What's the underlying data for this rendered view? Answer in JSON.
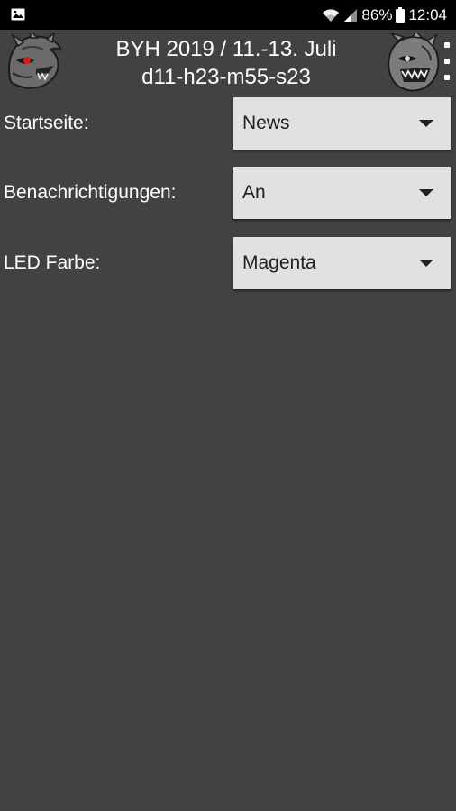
{
  "status_bar": {
    "battery_percent": "86%",
    "time": "12:04",
    "left_icon": "image-icon",
    "icons": [
      "wifi-icon",
      "signal-icon",
      "battery-icon"
    ]
  },
  "app_bar": {
    "title_line1": "BYH 2019 / 11.-13. Juli",
    "title_line2": "d11-h23-m55-s23",
    "left_logo": "dragon-logo-red",
    "right_logo": "dragon-logo-grey",
    "menu_icon": "overflow-menu-icon"
  },
  "settings": [
    {
      "label": "Startseite:",
      "value": "News"
    },
    {
      "label": "Benachrichtigungen:",
      "value": "An"
    },
    {
      "label": "LED Farbe:",
      "value": "Magenta"
    }
  ],
  "colors": {
    "background": "#424242",
    "status_bar": "#000000",
    "select_background": "#e1e1e1",
    "text": "#ffffff",
    "select_text": "#212121"
  }
}
